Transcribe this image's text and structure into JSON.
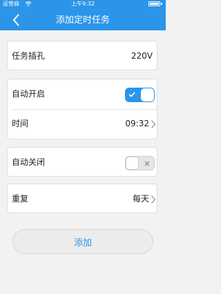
{
  "status_bar": {
    "carrier": "运营商",
    "time": "上午9:32"
  },
  "header": {
    "title": "添加定时任务",
    "back_icon": "chevron-left-icon"
  },
  "socket_row": {
    "label": "任务插孔",
    "value": "220V"
  },
  "auto_on": {
    "label": "自动开启",
    "enabled": true
  },
  "time_row": {
    "label": "时间",
    "value": "09:32"
  },
  "auto_off": {
    "label": "自动关闭",
    "enabled": false
  },
  "repeat_row": {
    "label": "重复",
    "value": "每天"
  },
  "add_button": {
    "label": "添加"
  },
  "colors": {
    "accent": "#2b95e9",
    "background": "#f2f2f2"
  }
}
